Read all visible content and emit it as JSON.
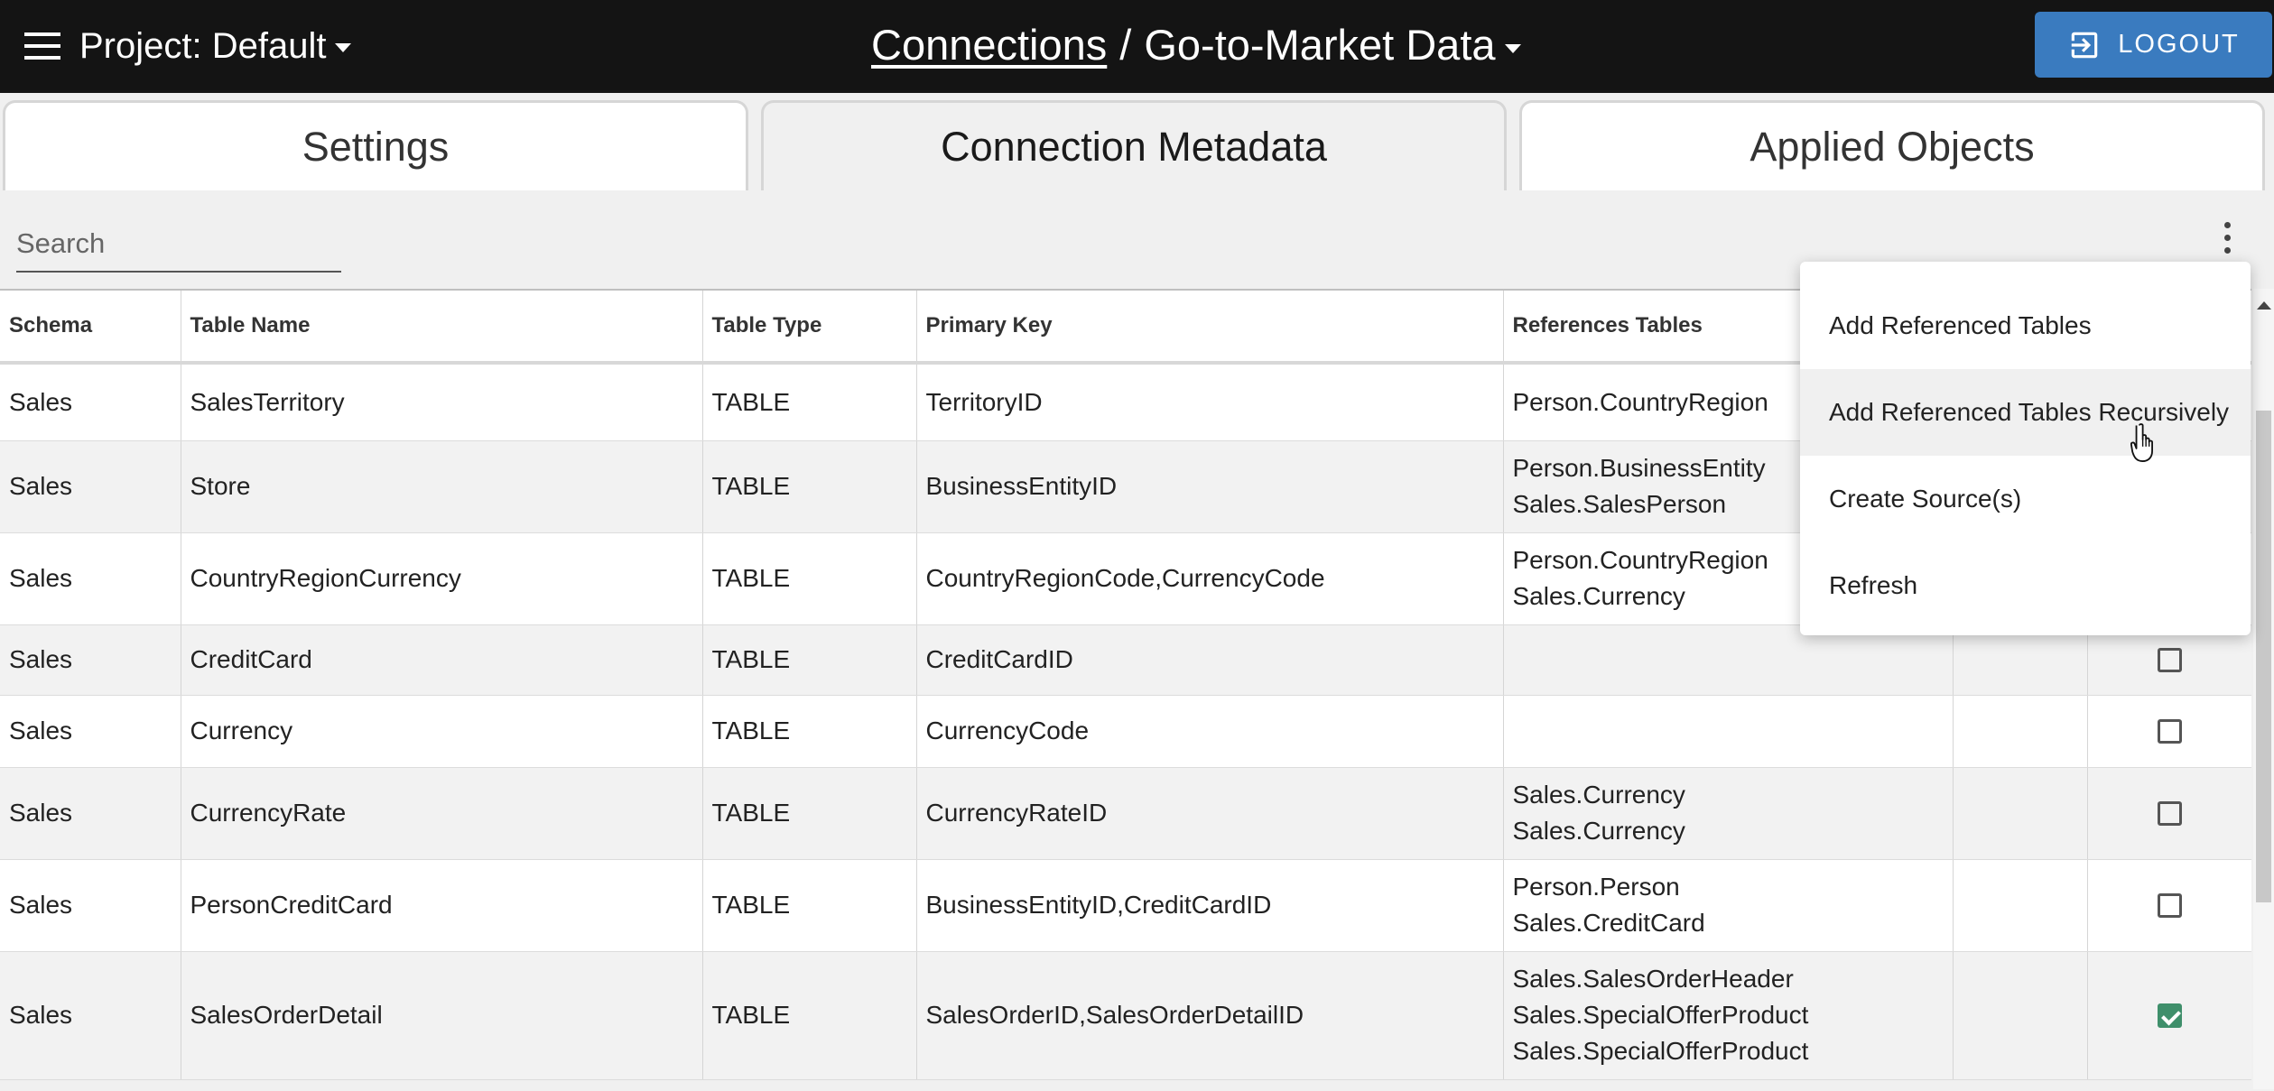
{
  "header": {
    "project_label": "Project:",
    "project_value": "Default",
    "breadcrumb_link": "Connections",
    "breadcrumb_separator": "/",
    "breadcrumb_current": "Go-to-Market Data",
    "logout_label": "LOGOUT"
  },
  "tabs": [
    {
      "label": "Settings"
    },
    {
      "label": "Connection Metadata"
    },
    {
      "label": "Applied Objects"
    }
  ],
  "search": {
    "placeholder": "Search"
  },
  "table": {
    "columns": [
      "Schema",
      "Table Name",
      "Table Type",
      "Primary Key",
      "References Tables"
    ],
    "rows": [
      {
        "schema": "Sales",
        "name": "SalesTerritory",
        "type": "TABLE",
        "pk": "TerritoryID",
        "refs": [
          "Person.CountryRegion"
        ],
        "checked": false
      },
      {
        "schema": "Sales",
        "name": "Store",
        "type": "TABLE",
        "pk": "BusinessEntityID",
        "refs": [
          "Person.BusinessEntity",
          "Sales.SalesPerson"
        ],
        "checked": false
      },
      {
        "schema": "Sales",
        "name": "CountryRegionCurrency",
        "type": "TABLE",
        "pk": "CountryRegionCode,CurrencyCode",
        "refs": [
          "Person.CountryRegion",
          "Sales.Currency"
        ],
        "checked": false
      },
      {
        "schema": "Sales",
        "name": "CreditCard",
        "type": "TABLE",
        "pk": "CreditCardID",
        "refs": [],
        "checked": false
      },
      {
        "schema": "Sales",
        "name": "Currency",
        "type": "TABLE",
        "pk": "CurrencyCode",
        "refs": [],
        "checked": false
      },
      {
        "schema": "Sales",
        "name": "CurrencyRate",
        "type": "TABLE",
        "pk": "CurrencyRateID",
        "refs": [
          "Sales.Currency",
          "Sales.Currency"
        ],
        "checked": false
      },
      {
        "schema": "Sales",
        "name": "PersonCreditCard",
        "type": "TABLE",
        "pk": "BusinessEntityID,CreditCardID",
        "refs": [
          "Person.Person",
          "Sales.CreditCard"
        ],
        "checked": false
      },
      {
        "schema": "Sales",
        "name": "SalesOrderDetail",
        "type": "TABLE",
        "pk": "SalesOrderID,SalesOrderDetailID",
        "refs": [
          "Sales.SalesOrderHeader",
          "Sales.SpecialOfferProduct",
          "Sales.SpecialOfferProduct"
        ],
        "checked": true
      }
    ]
  },
  "menu": {
    "items": [
      {
        "label": "Add Referenced Tables"
      },
      {
        "label": "Add Referenced Tables Recursively"
      },
      {
        "label": "Create Source(s)"
      },
      {
        "label": "Refresh"
      }
    ],
    "hovered_index": 1
  },
  "icons": {
    "menu": "hamburger-menu-icon",
    "logout": "logout-icon",
    "more": "more-vertical-icon",
    "cursor": "hand-pointer-cursor-icon"
  },
  "colors": {
    "topbar": "#141414",
    "logout_button": "#3a7bbf",
    "checkbox_checked": "#3f8f6b"
  }
}
